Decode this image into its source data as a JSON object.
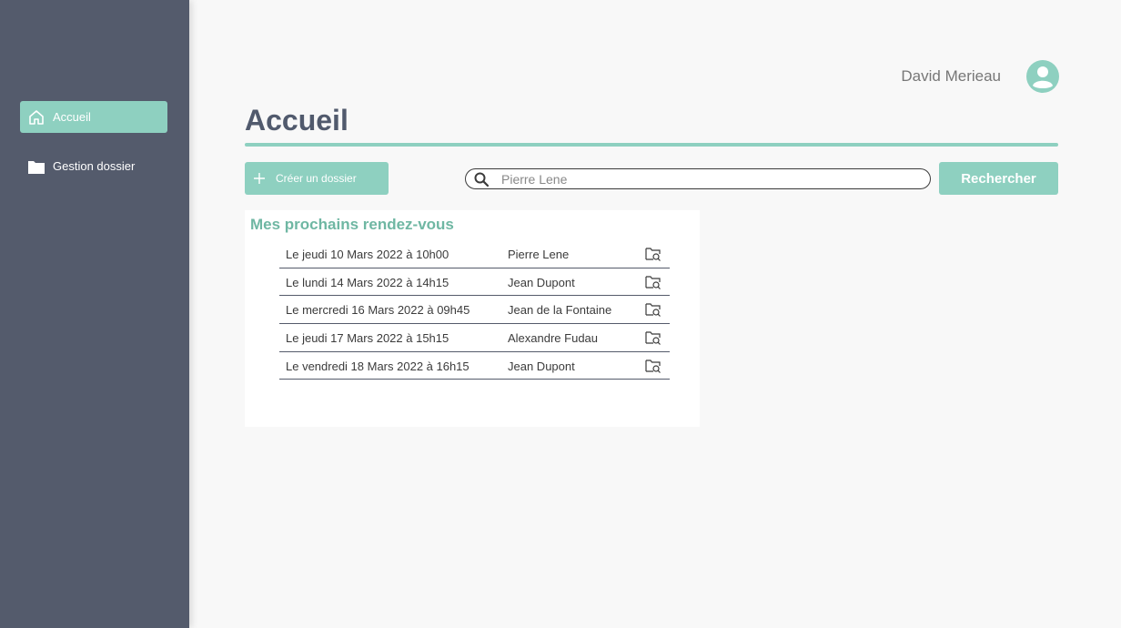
{
  "sidebar": {
    "items": [
      {
        "label": "Accueil",
        "icon": "home-icon",
        "active": true
      },
      {
        "label": "Gestion dossier",
        "icon": "folder-icon",
        "active": false
      }
    ]
  },
  "user": {
    "name": "David Merieau",
    "icon": "user-avatar-icon"
  },
  "page": {
    "title": "Accueil"
  },
  "toolbar": {
    "create_label": "Créer un dossier",
    "search_value": "Pierre Lene",
    "search_button_label": "Rechercher"
  },
  "appointments": {
    "title": "Mes prochains rendez-vous",
    "rows": [
      {
        "date": "Le jeudi 10 Mars 2022 à 10h00",
        "name": "Pierre Lene"
      },
      {
        "date": "Le lundi 14 Mars 2022 à 14h15",
        "name": "Jean Dupont"
      },
      {
        "date": "Le mercredi 16 Mars 2022 à 09h45",
        "name": "Jean de la Fontaine"
      },
      {
        "date": "Le jeudi 17 Mars 2022 à 15h15",
        "name": "Alexandre Fudau"
      },
      {
        "date": "Le vendredi 18 Mars 2022 à 16h15",
        "name": "Jean Dupont"
      }
    ]
  },
  "colors": {
    "sidebar": "#545b6c",
    "accent": "#8ed0c0",
    "section_title": "#6fb7a3",
    "page_title": "#515a6d"
  }
}
